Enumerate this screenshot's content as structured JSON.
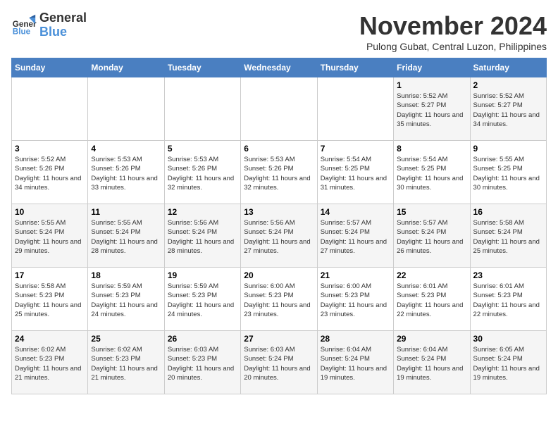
{
  "logo": {
    "line1": "General",
    "line2": "Blue"
  },
  "title": "November 2024",
  "location": "Pulong Gubat, Central Luzon, Philippines",
  "weekdays": [
    "Sunday",
    "Monday",
    "Tuesday",
    "Wednesday",
    "Thursday",
    "Friday",
    "Saturday"
  ],
  "rows": [
    [
      {
        "day": "",
        "info": ""
      },
      {
        "day": "",
        "info": ""
      },
      {
        "day": "",
        "info": ""
      },
      {
        "day": "",
        "info": ""
      },
      {
        "day": "",
        "info": ""
      },
      {
        "day": "1",
        "info": "Sunrise: 5:52 AM\nSunset: 5:27 PM\nDaylight: 11 hours and 35 minutes."
      },
      {
        "day": "2",
        "info": "Sunrise: 5:52 AM\nSunset: 5:27 PM\nDaylight: 11 hours and 34 minutes."
      }
    ],
    [
      {
        "day": "3",
        "info": "Sunrise: 5:52 AM\nSunset: 5:26 PM\nDaylight: 11 hours and 34 minutes."
      },
      {
        "day": "4",
        "info": "Sunrise: 5:53 AM\nSunset: 5:26 PM\nDaylight: 11 hours and 33 minutes."
      },
      {
        "day": "5",
        "info": "Sunrise: 5:53 AM\nSunset: 5:26 PM\nDaylight: 11 hours and 32 minutes."
      },
      {
        "day": "6",
        "info": "Sunrise: 5:53 AM\nSunset: 5:26 PM\nDaylight: 11 hours and 32 minutes."
      },
      {
        "day": "7",
        "info": "Sunrise: 5:54 AM\nSunset: 5:25 PM\nDaylight: 11 hours and 31 minutes."
      },
      {
        "day": "8",
        "info": "Sunrise: 5:54 AM\nSunset: 5:25 PM\nDaylight: 11 hours and 30 minutes."
      },
      {
        "day": "9",
        "info": "Sunrise: 5:55 AM\nSunset: 5:25 PM\nDaylight: 11 hours and 30 minutes."
      }
    ],
    [
      {
        "day": "10",
        "info": "Sunrise: 5:55 AM\nSunset: 5:24 PM\nDaylight: 11 hours and 29 minutes."
      },
      {
        "day": "11",
        "info": "Sunrise: 5:55 AM\nSunset: 5:24 PM\nDaylight: 11 hours and 28 minutes."
      },
      {
        "day": "12",
        "info": "Sunrise: 5:56 AM\nSunset: 5:24 PM\nDaylight: 11 hours and 28 minutes."
      },
      {
        "day": "13",
        "info": "Sunrise: 5:56 AM\nSunset: 5:24 PM\nDaylight: 11 hours and 27 minutes."
      },
      {
        "day": "14",
        "info": "Sunrise: 5:57 AM\nSunset: 5:24 PM\nDaylight: 11 hours and 27 minutes."
      },
      {
        "day": "15",
        "info": "Sunrise: 5:57 AM\nSunset: 5:24 PM\nDaylight: 11 hours and 26 minutes."
      },
      {
        "day": "16",
        "info": "Sunrise: 5:58 AM\nSunset: 5:24 PM\nDaylight: 11 hours and 25 minutes."
      }
    ],
    [
      {
        "day": "17",
        "info": "Sunrise: 5:58 AM\nSunset: 5:23 PM\nDaylight: 11 hours and 25 minutes."
      },
      {
        "day": "18",
        "info": "Sunrise: 5:59 AM\nSunset: 5:23 PM\nDaylight: 11 hours and 24 minutes."
      },
      {
        "day": "19",
        "info": "Sunrise: 5:59 AM\nSunset: 5:23 PM\nDaylight: 11 hours and 24 minutes."
      },
      {
        "day": "20",
        "info": "Sunrise: 6:00 AM\nSunset: 5:23 PM\nDaylight: 11 hours and 23 minutes."
      },
      {
        "day": "21",
        "info": "Sunrise: 6:00 AM\nSunset: 5:23 PM\nDaylight: 11 hours and 23 minutes."
      },
      {
        "day": "22",
        "info": "Sunrise: 6:01 AM\nSunset: 5:23 PM\nDaylight: 11 hours and 22 minutes."
      },
      {
        "day": "23",
        "info": "Sunrise: 6:01 AM\nSunset: 5:23 PM\nDaylight: 11 hours and 22 minutes."
      }
    ],
    [
      {
        "day": "24",
        "info": "Sunrise: 6:02 AM\nSunset: 5:23 PM\nDaylight: 11 hours and 21 minutes."
      },
      {
        "day": "25",
        "info": "Sunrise: 6:02 AM\nSunset: 5:23 PM\nDaylight: 11 hours and 21 minutes."
      },
      {
        "day": "26",
        "info": "Sunrise: 6:03 AM\nSunset: 5:23 PM\nDaylight: 11 hours and 20 minutes."
      },
      {
        "day": "27",
        "info": "Sunrise: 6:03 AM\nSunset: 5:24 PM\nDaylight: 11 hours and 20 minutes."
      },
      {
        "day": "28",
        "info": "Sunrise: 6:04 AM\nSunset: 5:24 PM\nDaylight: 11 hours and 19 minutes."
      },
      {
        "day": "29",
        "info": "Sunrise: 6:04 AM\nSunset: 5:24 PM\nDaylight: 11 hours and 19 minutes."
      },
      {
        "day": "30",
        "info": "Sunrise: 6:05 AM\nSunset: 5:24 PM\nDaylight: 11 hours and 19 minutes."
      }
    ]
  ]
}
